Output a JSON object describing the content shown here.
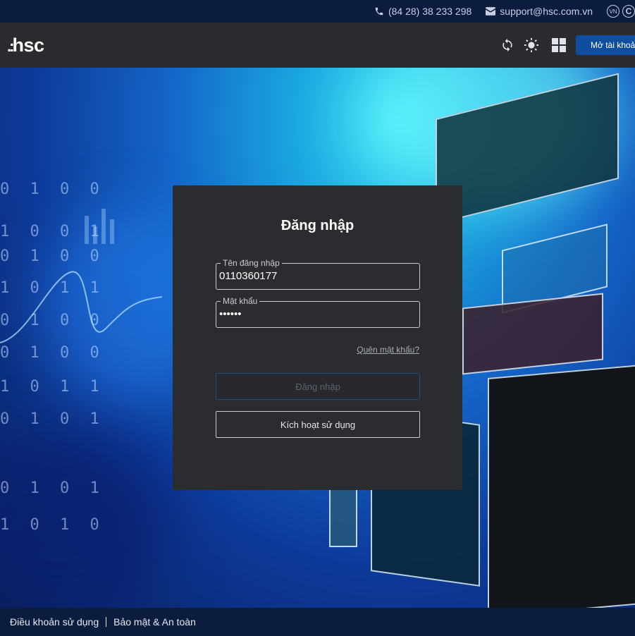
{
  "topbar": {
    "phone": "(84 28) 38 233 298",
    "email": "support@hsc.com.vn",
    "lang_badge": "VN",
    "copyright_badge": "C"
  },
  "header": {
    "logo_text": "hsc",
    "logo_dots": ".:",
    "open_account_label": "Mở tài khoản",
    "icons": [
      "refresh-icon",
      "brightness-icon",
      "grid-icon"
    ]
  },
  "login": {
    "title": "Đăng nhập",
    "username_label": "Tên đăng nhập",
    "username_value": "0110360177",
    "password_label": "Mật khẩu",
    "password_value": "••••••",
    "forgot_label": "Quên mật khẩu?",
    "login_button": "Đăng nhập",
    "activate_button": "Kích hoạt sử dụng"
  },
  "footer": {
    "terms": "Điều khoản sử dụng",
    "security": "Bảo mật & An toàn"
  },
  "colors": {
    "topbar_bg": "#0b1c3f",
    "header_bg": "#2a2b2f",
    "card_bg": "#2b2c30",
    "accent": "#0f4e9e"
  }
}
